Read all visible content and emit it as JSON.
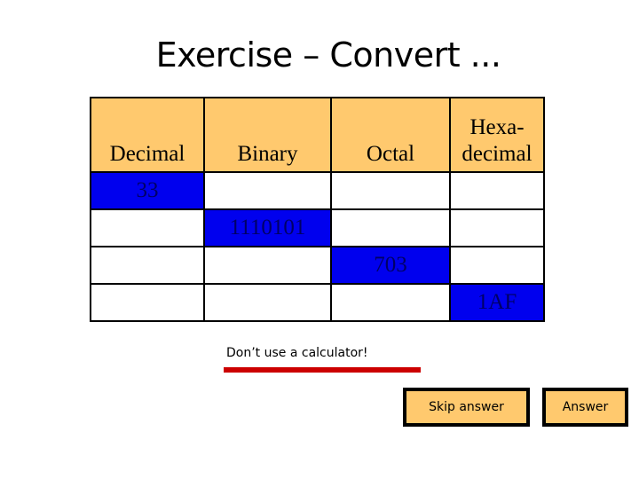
{
  "slide": {
    "title": "Exercise – Convert ...",
    "table": {
      "headers": [
        "Decimal",
        "Binary",
        "Octal",
        "Hexa-\ndecimal"
      ],
      "header_lines": {
        "hex_line1": "Hexa-",
        "hex_line2": "decimal"
      },
      "rows": [
        [
          "33",
          "",
          "",
          ""
        ],
        [
          "",
          "1110101",
          "",
          ""
        ],
        [
          "",
          "",
          "703",
          ""
        ],
        [
          "",
          "",
          "",
          "1AF"
        ]
      ]
    },
    "note": "Don’t use a calculator!",
    "buttons": {
      "skip": "Skip answer",
      "answer": "Answer"
    },
    "colors": {
      "header_bg": "#ffc96e",
      "given_cell": "#0000ee",
      "underline": "#cc0000"
    }
  }
}
